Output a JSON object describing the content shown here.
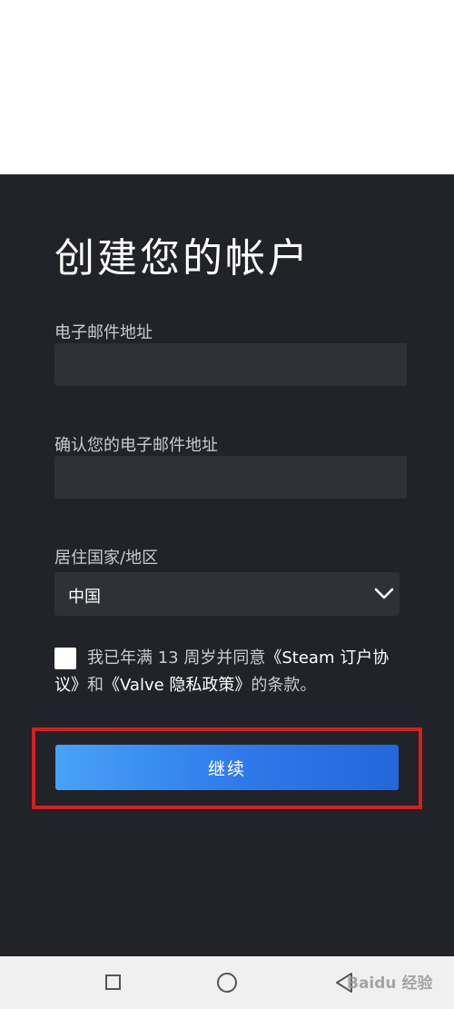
{
  "page": {
    "title": "创建您的帐户"
  },
  "form": {
    "email_label": "电子邮件地址",
    "email_value": "",
    "confirm_email_label": "确认您的电子邮件地址",
    "confirm_email_value": "",
    "country_label": "居住国家/地区",
    "country_selected": "中国"
  },
  "agreement": {
    "text_prefix": "我已年满 13 周岁并同意",
    "ssa_link": "《Steam 订户协议》",
    "text_middle": "和",
    "privacy_link": "《Valve 隐私政策》",
    "text_suffix": "的条款。",
    "checked": false
  },
  "continue_button": {
    "label": "继续"
  },
  "colors": {
    "panel_bg": "#212329",
    "input_bg": "#2f3137",
    "button_blue": "#2e79ea",
    "highlight_red": "#d51f1f"
  },
  "nav_bar": {
    "icons": [
      "square-recents-icon",
      "circle-home-icon",
      "triangle-back-icon"
    ]
  },
  "watermark": {
    "text": "Baidu 经验"
  }
}
